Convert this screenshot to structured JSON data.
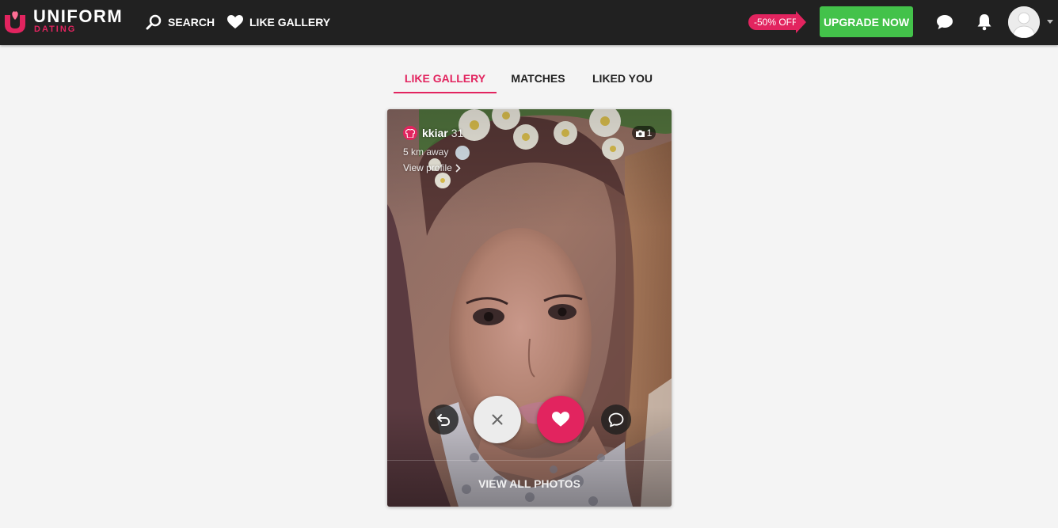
{
  "brand": {
    "name": "UNIFORM",
    "sub": "DATING",
    "accent_color": "#e2245f"
  },
  "nav": {
    "search_label": "SEARCH",
    "search_icon": "search-icon",
    "gallery_label": "LIKE GALLERY",
    "gallery_icon": "heart-icon"
  },
  "promo": {
    "discount_label": "-50% OFF",
    "upgrade_label": "UPGRADE NOW",
    "upgrade_color": "#43c24a"
  },
  "header_icons": [
    "chat-icon",
    "bell-icon",
    "avatar",
    "caret-down-icon"
  ],
  "tabs": [
    {
      "label": "LIKE GALLERY",
      "active": true
    },
    {
      "label": "MATCHES",
      "active": false
    },
    {
      "label": "LIKED YOU",
      "active": false
    }
  ],
  "card": {
    "username": "kkiar",
    "age": "31",
    "distance": "5 km away",
    "view_profile": "View profile",
    "photo_count": "1",
    "view_all_label": "VIEW ALL PHOTOS",
    "actions": [
      "undo-icon",
      "close-icon",
      "heart-icon",
      "message-icon"
    ]
  }
}
